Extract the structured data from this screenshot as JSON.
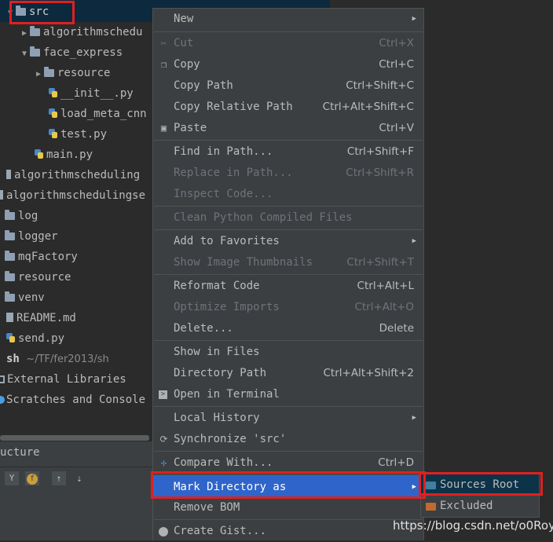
{
  "project_tree": {
    "items": [
      {
        "label": "src"
      },
      {
        "label": "algorithmschedu"
      },
      {
        "label": "face_express"
      },
      {
        "label": "resource"
      },
      {
        "label": "__init__.py"
      },
      {
        "label": "load_meta_cnn"
      },
      {
        "label": "test.py"
      },
      {
        "label": "main.py"
      },
      {
        "label": "algorithmscheduling"
      },
      {
        "label": "algorithmschedulingse"
      },
      {
        "label": "log"
      },
      {
        "label": "logger"
      },
      {
        "label": "mqFactory"
      },
      {
        "label": "resource"
      },
      {
        "label": "venv"
      },
      {
        "label": "README.md"
      },
      {
        "label": "send.py"
      },
      {
        "label": "sh",
        "path": "~/TF/fer2013/sh"
      },
      {
        "label": "External Libraries"
      },
      {
        "label": "Scratches and Console"
      }
    ]
  },
  "structure_panel": {
    "title": "ucture"
  },
  "context_menu": {
    "items": [
      {
        "label": "New"
      },
      {
        "label": "Cut",
        "shortcut": "Ctrl+X"
      },
      {
        "label": "Copy",
        "shortcut": "Ctrl+C"
      },
      {
        "label": "Copy Path",
        "shortcut": "Ctrl+Shift+C"
      },
      {
        "label": "Copy Relative Path",
        "shortcut": "Ctrl+Alt+Shift+C"
      },
      {
        "label": "Paste",
        "shortcut": "Ctrl+V"
      },
      {
        "label": "Find in Path...",
        "shortcut": "Ctrl+Shift+F"
      },
      {
        "label": "Replace in Path...",
        "shortcut": "Ctrl+Shift+R"
      },
      {
        "label": "Inspect Code..."
      },
      {
        "label": "Clean Python Compiled Files"
      },
      {
        "label": "Add to Favorites"
      },
      {
        "label": "Show Image Thumbnails",
        "shortcut": "Ctrl+Shift+T"
      },
      {
        "label": "Reformat Code",
        "shortcut": "Ctrl+Alt+L"
      },
      {
        "label": "Optimize Imports",
        "shortcut": "Ctrl+Alt+O"
      },
      {
        "label": "Delete...",
        "shortcut": "Delete"
      },
      {
        "label": "Show in Files"
      },
      {
        "label": "Directory Path",
        "shortcut": "Ctrl+Alt+Shift+2"
      },
      {
        "label": "Open in Terminal"
      },
      {
        "label": "Local History"
      },
      {
        "label": "Synchronize 'src'"
      },
      {
        "label": "Compare With...",
        "shortcut": "Ctrl+D"
      },
      {
        "label": "Mark Directory as"
      },
      {
        "label": "Remove BOM"
      },
      {
        "label": "Create Gist..."
      }
    ]
  },
  "submenu": {
    "items": [
      {
        "label": "Sources Root",
        "color": "#3f7f9f"
      },
      {
        "label": "Excluded",
        "color": "#c06a2e"
      }
    ]
  },
  "watermark": "https://blog.csdn.net/o0Roy"
}
